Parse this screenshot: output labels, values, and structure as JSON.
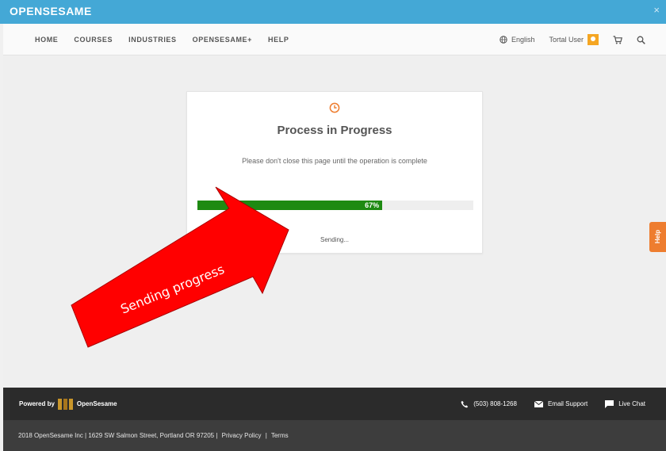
{
  "titlebar": {
    "brand": "OPENSESAME",
    "close": "×"
  },
  "nav": {
    "items": [
      "HOME",
      "COURSES",
      "INDUSTRIES",
      "OPENSESAME+",
      "HELP"
    ],
    "language": "English",
    "user": "Tortal User",
    "icons": {
      "language": "globe-icon",
      "cart": "cart-icon",
      "search": "search-icon",
      "avatar": "avatar-icon"
    }
  },
  "dialog": {
    "icon": "clock-icon",
    "title": "Process in Progress",
    "message": "Please don't close this page until the operation is complete",
    "progress": {
      "percent": 67,
      "label": "67%"
    },
    "status": "Sending..."
  },
  "help_tab": {
    "label": "Help"
  },
  "annotation": {
    "text": "Sending progress",
    "color": "#ff0000"
  },
  "footer": {
    "powered_by": "Powered by",
    "brand": "OpenSesame",
    "phone": "(503) 808-1268",
    "email_support": "Email Support",
    "live_chat": "Live Chat",
    "legal": {
      "address": "2018 OpenSesame Inc | 1629 SW Salmon Street, Portland OR 97205 |",
      "privacy": "Privacy Policy",
      "separator": "|",
      "terms": "Terms"
    }
  },
  "colors": {
    "titlebar": "#44a8d6",
    "progress_fill": "#1e8a12",
    "accent_orange": "#ee7d2f",
    "footer_dark": "#2b2b2b",
    "footer_darker": "#3d3d3d"
  }
}
